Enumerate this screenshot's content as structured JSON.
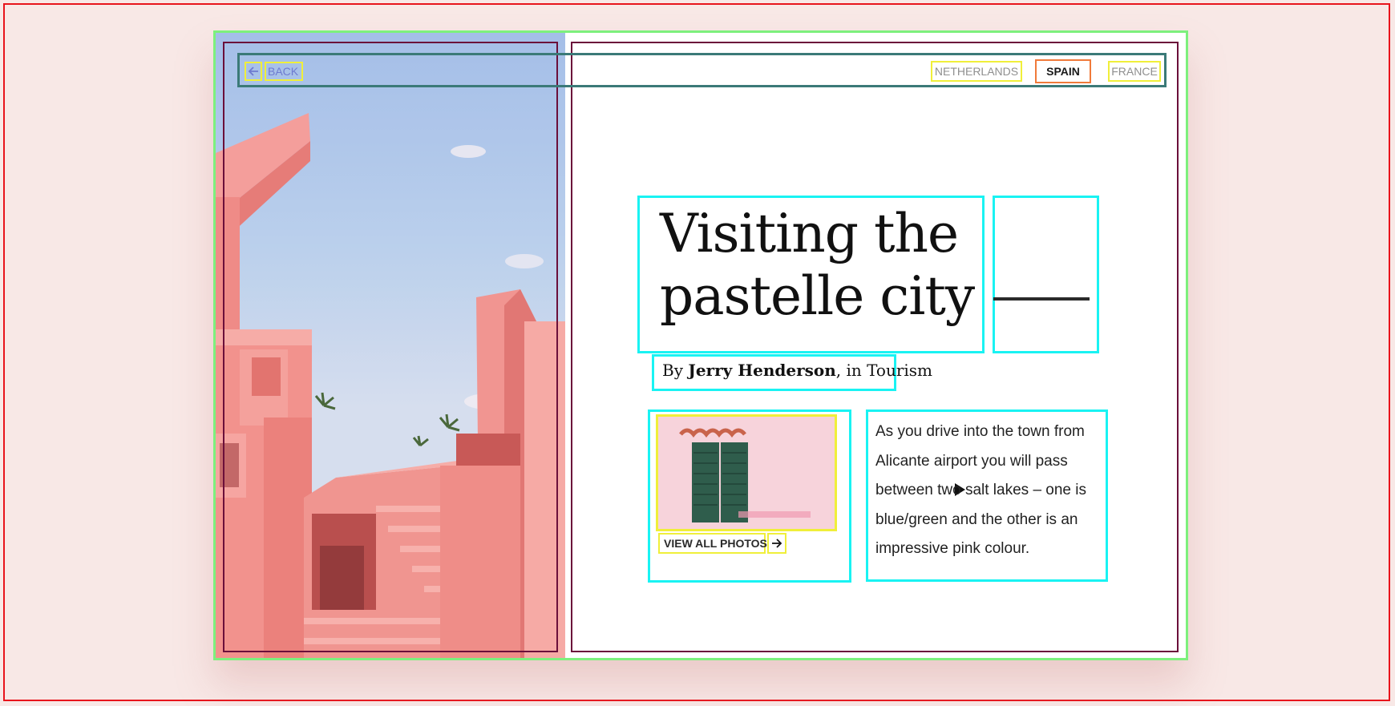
{
  "nav": {
    "back_label": "BACK",
    "tabs": [
      {
        "label": "NETHERLANDS",
        "active": false
      },
      {
        "label": "SPAIN",
        "active": true
      },
      {
        "label": "FRANCE",
        "active": false
      }
    ]
  },
  "article": {
    "title_line1": "Visiting the",
    "title_line2": "pastelle city",
    "byline_prefix": "By",
    "author": "Jerry Henderson",
    "byline_suffix": ", in Tourism",
    "media": {
      "view_all_label": "VIEW ALL PHOTOS"
    },
    "body": "As you drive into the town from Alicante airport you will pass between two salt lakes – one is blue/green and the other is an impressive pink colour."
  },
  "icons": {
    "back": "arrow-left-icon",
    "view_all": "arrow-right-icon",
    "play": "play-icon"
  },
  "colors": {
    "page_background": "#f8e8e6",
    "accent_link": "#6e7bd0",
    "building_pink": "#f08b86",
    "sky_blue": "#a9cdf4",
    "shutter_green": "#2f5d4c"
  }
}
